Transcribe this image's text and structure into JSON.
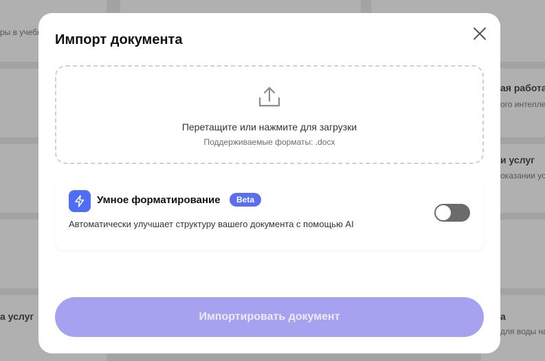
{
  "background": {
    "fragments": [
      "ры в учебн",
      "ая работа",
      "ого интеллек",
      "и услуг",
      "оказании усл",
      "а услуг",
      "а",
      "для воды на"
    ]
  },
  "modal": {
    "title": "Импорт документа",
    "close_icon": "close-icon"
  },
  "dropzone": {
    "icon": "upload-icon",
    "title": "Перетащите или нажмите для загрузки",
    "subtitle": "Поддерживаемые форматы: .docx"
  },
  "smart_formatting": {
    "icon": "lightning-icon",
    "title": "Умное форматирование",
    "badge": "Beta",
    "description": "Автоматически улучшает структуру вашего документа с помощью AI",
    "enabled": false
  },
  "import_button": {
    "label": "Импортировать документ"
  },
  "colors": {
    "accent": "#4f6df5",
    "badge": "#5b6ef2",
    "button_disabled": "#a6a2f0",
    "toggle_off": "#6b6b6b"
  }
}
